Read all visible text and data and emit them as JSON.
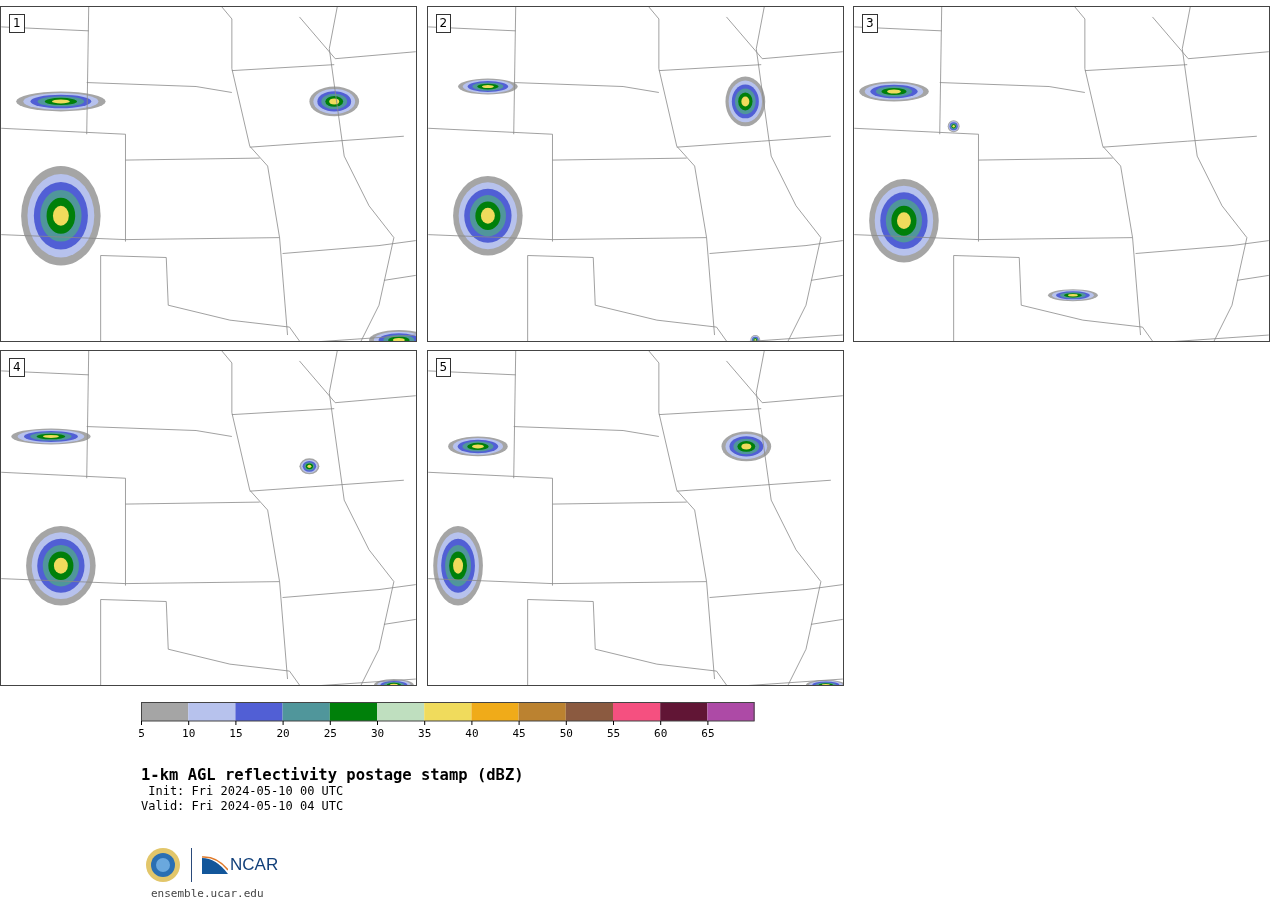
{
  "panels": [
    {
      "label": "1"
    },
    {
      "label": "2"
    },
    {
      "label": "3"
    },
    {
      "label": "4"
    },
    {
      "label": "5"
    }
  ],
  "colorbar": {
    "segments": [
      {
        "color": "#a5a5a5"
      },
      {
        "color": "#b7c2ed"
      },
      {
        "color": "#515fd5"
      },
      {
        "color": "#50969b"
      },
      {
        "color": "#00800a"
      },
      {
        "color": "#bfdfbf"
      },
      {
        "color": "#f0db5c"
      },
      {
        "color": "#f0ab19"
      },
      {
        "color": "#bb8230"
      },
      {
        "color": "#8b5a40"
      },
      {
        "color": "#f55080"
      },
      {
        "color": "#611535"
      },
      {
        "color": "#ad4aa6"
      }
    ],
    "ticks": [
      "5",
      "10",
      "15",
      "20",
      "25",
      "30",
      "35",
      "40",
      "45",
      "50",
      "55",
      "60",
      "65"
    ]
  },
  "title": "1-km AGL reflectivity postage stamp (dBZ)",
  "init": " Init: Fri 2024-05-10 00 UTC",
  "valid": "Valid: Fri 2024-05-10 04 UTC",
  "logo_text": "NCAR",
  "url": "ensemble.ucar.edu"
}
